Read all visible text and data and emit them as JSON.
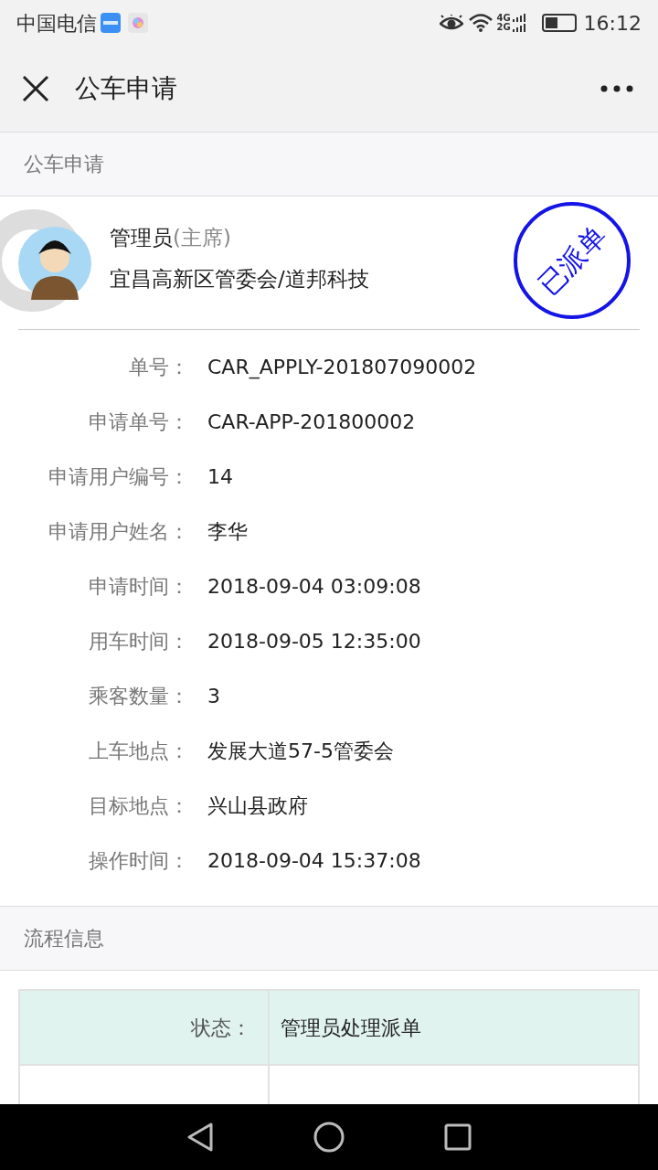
{
  "status_bar": {
    "carrier": "中国电信",
    "network": "4G\n2G",
    "time": "16:12"
  },
  "title_bar": {
    "title": "公车申请"
  },
  "sections": [
    {
      "title": "公车申请"
    },
    {
      "title": "流程信息"
    }
  ],
  "applicant": {
    "name": "管理员",
    "role": "(主席)",
    "org": "宜昌高新区管委会/道邦科技",
    "stamp": "已派单"
  },
  "fields": [
    {
      "label": "单号：",
      "value": "CAR_APPLY-201807090002"
    },
    {
      "label": "申请单号：",
      "value": "CAR-APP-201800002"
    },
    {
      "label": "申请用户编号：",
      "value": "14"
    },
    {
      "label": "申请用户姓名：",
      "value": "李华"
    },
    {
      "label": "申请时间：",
      "value": "2018-09-04 03:09:08"
    },
    {
      "label": "用车时间：",
      "value": "2018-09-05 12:35:00"
    },
    {
      "label": "乘客数量：",
      "value": "3"
    },
    {
      "label": "上车地点：",
      "value": "发展大道57-5管委会"
    },
    {
      "label": "目标地点：",
      "value": "兴山县政府"
    },
    {
      "label": "操作时间：",
      "value": "2018-09-04 15:37:08"
    }
  ],
  "process_table": [
    {
      "label": "状态：",
      "value": "管理员处理派单",
      "highlighted": true
    },
    {
      "highlighted": false
    }
  ]
}
